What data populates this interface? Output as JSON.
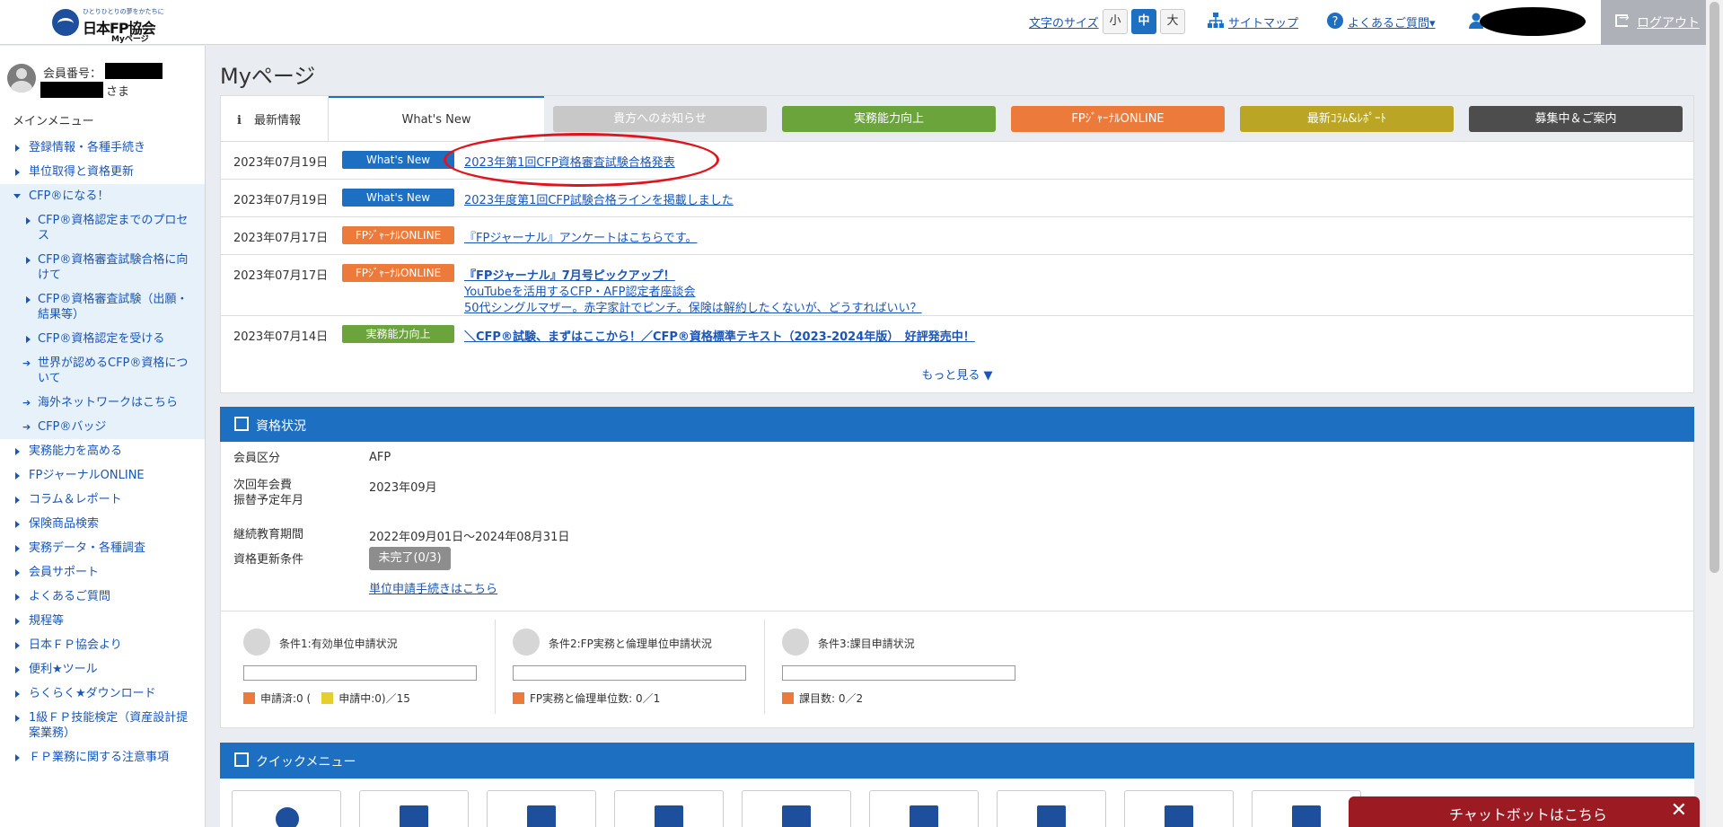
{
  "header": {
    "logo_tagline": "ひとりひとりの夢をかたちに",
    "logo_name": "日本FP協会",
    "logo_sub": "Myページ",
    "font_size_label": "文字のサイズ",
    "font_sizes": [
      "小",
      "中",
      "大"
    ],
    "sitemap": "サイトマップ",
    "faq": "よくあるご質問",
    "logout": "ログアウト"
  },
  "sidebar": {
    "member_no_label": "会員番号：",
    "sama": "さま",
    "menu_title": "メインメニュー",
    "items": [
      {
        "label": "登録情報・各種手続き",
        "kind": "top"
      },
      {
        "label": "単位取得と資格更新",
        "kind": "top"
      },
      {
        "label": "CFP®になる！",
        "kind": "open"
      },
      {
        "label": "CFP®資格認定までのプロセス",
        "kind": "sub"
      },
      {
        "label": "CFP®資格審査試験合格に向けて",
        "kind": "sub"
      },
      {
        "label": "CFP®資格審査試験（出願・結果等）",
        "kind": "sub"
      },
      {
        "label": "CFP®資格認定を受ける",
        "kind": "sub"
      },
      {
        "label": "世界が認めるCFP®資格について",
        "kind": "arrow"
      },
      {
        "label": "海外ネットワークはこちら",
        "kind": "arrow"
      },
      {
        "label": "CFP®バッジ",
        "kind": "arrow"
      },
      {
        "label": "実務能力を高める",
        "kind": "top"
      },
      {
        "label": "FPジャーナルONLINE",
        "kind": "top"
      },
      {
        "label": "コラム＆レポート",
        "kind": "top"
      },
      {
        "label": "保険商品検索",
        "kind": "top"
      },
      {
        "label": "実務データ・各種調査",
        "kind": "top"
      },
      {
        "label": "会員サポート",
        "kind": "top"
      },
      {
        "label": "よくあるご質問",
        "kind": "top"
      },
      {
        "label": "規程等",
        "kind": "top"
      },
      {
        "label": "日本ＦＰ協会より",
        "kind": "top"
      },
      {
        "label": "便利★ツール",
        "kind": "top"
      },
      {
        "label": "らくらく★ダウンロード",
        "kind": "top"
      },
      {
        "label": "1級ＦＰ技能検定（資産設計提案業務）",
        "kind": "top"
      },
      {
        "label": "ＦＰ業務に関する注意事項",
        "kind": "top"
      }
    ]
  },
  "main": {
    "page_title": "Myページ",
    "news": {
      "tab_latest": "最新情報",
      "tab_whats_new": "What's New",
      "tabs": [
        {
          "label": "貴方へのお知らせ",
          "color": "#c8c8c8"
        },
        {
          "label": "実務能力向上",
          "color": "#6aa43a"
        },
        {
          "label": "FPｼﾞｬｰﾅﾙONLINE",
          "color": "#ec7a3b"
        },
        {
          "label": "最新ｺﾗﾑ&ﾚﾎﾟｰﾄ",
          "color": "#baa524"
        },
        {
          "label": "募集中＆ご案内",
          "color": "#4d4d4d"
        }
      ],
      "rows": [
        {
          "date": "2023年07月19日",
          "badge": "What's New",
          "badge_color": "#1d6fc2",
          "links": [
            "2023年第1回CFP資格審査試験合格発表"
          ],
          "bold": false
        },
        {
          "date": "2023年07月19日",
          "badge": "What's New",
          "badge_color": "#1d6fc2",
          "links": [
            "2023年度第1回CFP試験合格ラインを掲載しました"
          ],
          "bold": false
        },
        {
          "date": "2023年07月17日",
          "badge": "FPｼﾞｬｰﾅﾙONLINE",
          "badge_color": "#ec7a3b",
          "links": [
            "『FPジャーナル』アンケートはこちらです。"
          ],
          "bold": false
        },
        {
          "date": "2023年07月17日",
          "badge": "FPｼﾞｬｰﾅﾙONLINE",
          "badge_color": "#ec7a3b",
          "links": [
            "『FPジャーナル』7月号ピックアップ！",
            "YouTubeを活用するCFP・AFP認定者座談会",
            "50代シングルマザー。赤字家計でピンチ。保険は解約したくないが、どうすればいい？"
          ],
          "bold": true
        },
        {
          "date": "2023年07月14日",
          "badge": "実務能力向上",
          "badge_color": "#6aa43a",
          "links": [
            "＼CFP®試験、まずはここから！／CFP®資格標準テキスト（2023-2024年版）　好評発売中！"
          ],
          "bold": true
        }
      ],
      "more": "もっと見る ▼"
    },
    "status": {
      "title": "資格状況",
      "rows": [
        {
          "label": "会員区分",
          "value": "AFP"
        },
        {
          "label": "次回年会費\n振替予定年月",
          "value": "2023年09月"
        },
        {
          "label": "継続教育期間",
          "value": "2022年09月01日～2024年08月31日"
        },
        {
          "label": "資格更新条件",
          "value": ""
        }
      ],
      "pill": "未完了(0/3)",
      "apply_link": "単位申請手続きはこちら",
      "conditions": [
        {
          "title": "条件1:有効単位申請状況",
          "legend": "申請済:0 (",
          "legend2": "申請中:0)／15",
          "progress": 0
        },
        {
          "title": "条件2:FP実務と倫理単位申請状況",
          "legend": "FP実務と倫理単位数: 0／1",
          "legend2": "",
          "progress": 0
        },
        {
          "title": "条件3:課目申請状況",
          "legend": "課目数: 0／2",
          "legend2": "",
          "progress": 0
        }
      ]
    },
    "quick_menu": {
      "title": "クイックメニュー"
    }
  },
  "chatbot": {
    "label": "チャットボットはこちら",
    "close": "✕"
  }
}
